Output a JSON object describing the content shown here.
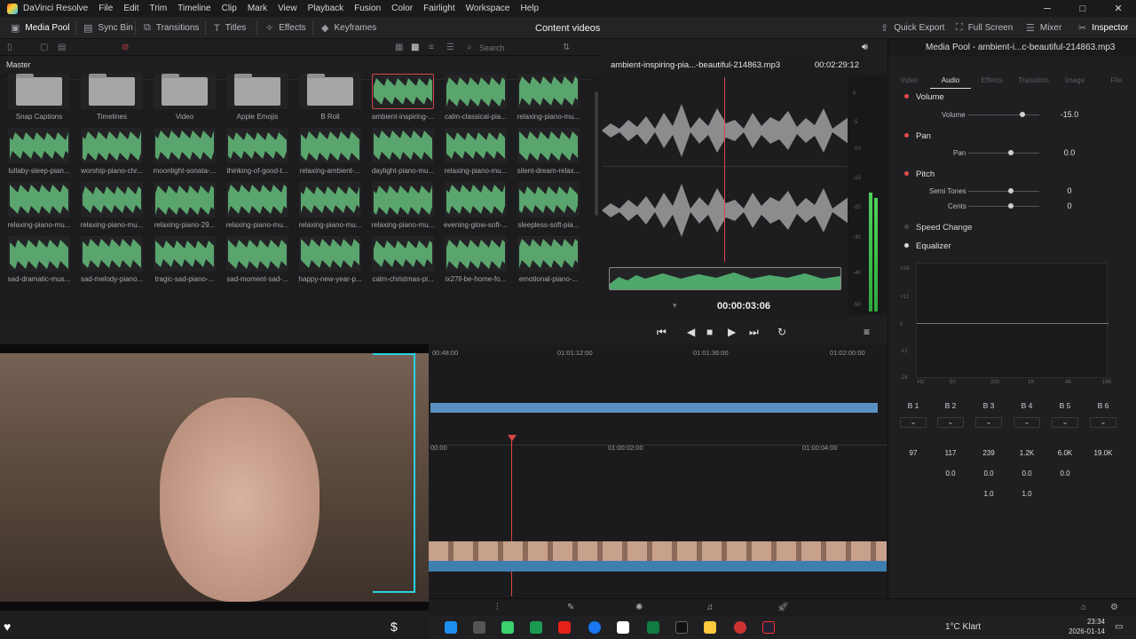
{
  "menu": {
    "app": "DaVinci Resolve",
    "items": [
      "File",
      "Edit",
      "Trim",
      "Timeline",
      "Clip",
      "Mark",
      "View",
      "Playback",
      "Fusion",
      "Color",
      "Fairlight",
      "Workspace",
      "Help"
    ]
  },
  "toolbar": {
    "media_pool": "Media Pool",
    "sync_bin": "Sync Bin",
    "transitions": "Transitions",
    "titles": "Titles",
    "effects": "Effects",
    "keyframes": "Keyframes",
    "project_title": "Content videos",
    "quick_export": "Quick Export",
    "full_screen": "Full Screen",
    "mixer": "Mixer",
    "inspector": "Inspector"
  },
  "pool": {
    "search_placeholder": "Search",
    "master": "Master",
    "folders": [
      "Snap Captions",
      "Timelines",
      "Video",
      "Apple Emojis",
      "B Roll"
    ],
    "clips": [
      "ambient-inspiring-...",
      "calm-classical-pia...",
      "relaxing-piano-mu...",
      "lullaby-sleep-pian...",
      "worship-piano-chr...",
      "moonlight-sonata-...",
      "thinking-of-good-t...",
      "relaxing-ambient-...",
      "daylight-piano-mu...",
      "relaxing-piano-mu...",
      "silent-dream-relax...",
      "relaxing-piano-mu...",
      "relaxing-piano-mu...",
      "relaxing-piano-29...",
      "relaxing-piano-mu...",
      "relaxing-piano-mu...",
      "relaxing-piano-mu...",
      "evening-glow-soft-...",
      "sleepless-soft-pia...",
      "sad-dramatic-mus...",
      "sad-melody-piano...",
      "tragic-sad-piano-...",
      "sad-moment-sad-...",
      "happy-new-year-p...",
      "calm-christmas-pi...",
      "ix27ll-be-home-fo...",
      "emotional-piano-..."
    ]
  },
  "viewer": {
    "clip_name": "ambient-inspiring-pia...-beautiful-214863.mp3",
    "duration": "00:02:29:12",
    "timecode": "00:00:03:06"
  },
  "inspector": {
    "title": "Media Pool - ambient-i...c-beautiful-214863.mp3",
    "tabs": [
      "Video",
      "Audio",
      "Effects",
      "Transition",
      "Image",
      "File"
    ],
    "volume": {
      "section": "Volume",
      "label": "Volume",
      "value": "-15.0"
    },
    "pan": {
      "section": "Pan",
      "label": "Pan",
      "value": "0.0"
    },
    "pitch": {
      "section": "Pitch",
      "semitones_label": "Semi Tones",
      "semitones": "0",
      "cents_label": "Cents",
      "cents": "0"
    },
    "speed_change": "Speed Change",
    "equalizer": "Equalizer",
    "eq_db": [
      "+24",
      "+12",
      "0",
      "-12",
      "-24"
    ],
    "eq_freq": [
      "Hz",
      "50",
      "200",
      "1K",
      "4K",
      "16K"
    ],
    "bands": [
      "B 1",
      "B 2",
      "B 3",
      "B 4",
      "B 5",
      "B 6"
    ],
    "band_freq": [
      "97",
      "117",
      "239",
      "1.2K",
      "6.0K",
      "19.0K"
    ],
    "band_gain": [
      "0.0",
      "0.0",
      "0.0",
      "0.0"
    ],
    "band_q": [
      "1.0",
      "1.0"
    ]
  },
  "timeline": {
    "ruler_top": [
      "00:48:00",
      "01:01:12:00",
      "01:01:36:00",
      "01:02:00:00"
    ],
    "ruler_bottom": [
      "00:00",
      "01:00:02:00",
      "01:00:04:00"
    ]
  },
  "taskbar": {
    "weather": "1°C  Klart",
    "time": "23:34",
    "date": "2026-01-14"
  },
  "scope_db": [
    "0",
    "-5",
    "-10",
    "-15",
    "-20",
    "-30",
    "-40",
    "-50"
  ]
}
